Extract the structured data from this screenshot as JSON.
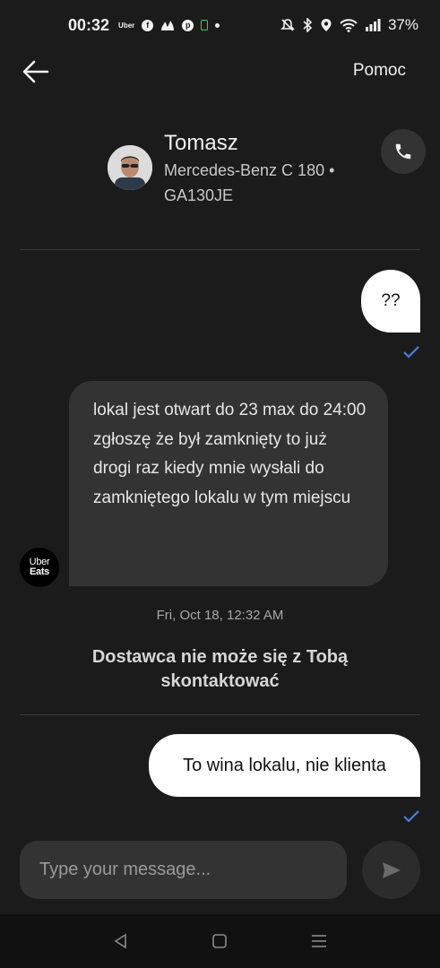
{
  "status_bar": {
    "time": "00:32",
    "uber_mini": "Uber",
    "battery": "37%",
    "left_icons": [
      "uber-icon",
      "facebook-icon",
      "fire-icon",
      "pinterest-icon",
      "battery-saver-icon",
      "dot-icon"
    ],
    "right_icons": [
      "mute-icon",
      "bluetooth-icon",
      "location-icon",
      "wifi-icon",
      "signal-icon"
    ]
  },
  "header": {
    "help_label": "Pomoc"
  },
  "driver": {
    "name": "Tomasz",
    "car": "Mercedes-Benz C 180 • GA130JE"
  },
  "messages": {
    "out_1": "??",
    "in_1": "lokal jest otwart do 23 max do 24:00 zgłoszę że był zamknięty to już drogi raz kiedy mnie wysłali do zamkniętego lokalu w tym miejscu",
    "logo_line1": "Uber",
    "logo_line2": "Eats",
    "timestamp": "Fri, Oct 18, 12:32 AM",
    "system": "Dostawca nie może się z Tobą skontaktować",
    "out_2": "To wina lokalu, nie klienta"
  },
  "composer": {
    "placeholder": "Type your message..."
  },
  "colors": {
    "background": "#1b1b1b",
    "bubble_out": "#ffffff",
    "bubble_in": "#333333",
    "read_check": "#4a7fd4"
  }
}
